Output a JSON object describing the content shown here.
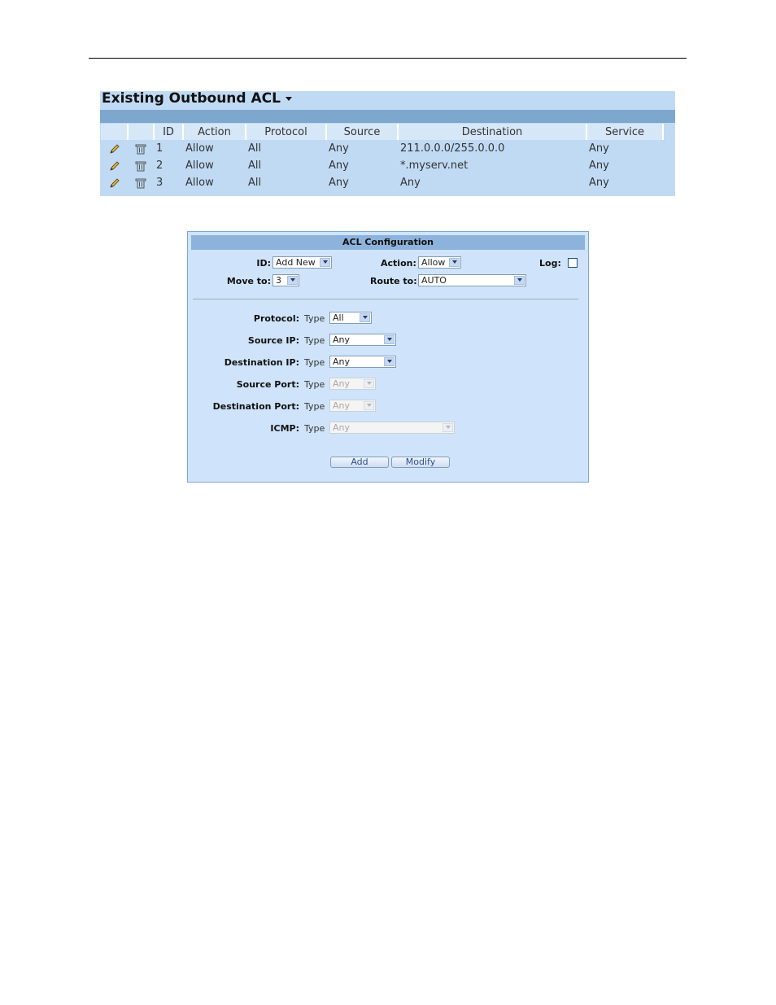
{
  "acl_list": {
    "title": "Existing Outbound ACL",
    "columns": [
      "",
      "",
      "ID",
      "Action",
      "Protocol",
      "Source",
      "Destination",
      "Service"
    ],
    "rows": [
      {
        "id": "1",
        "action": "Allow",
        "protocol": "All",
        "source": "Any",
        "destination": "211.0.0.0/255.0.0.0",
        "service": "Any"
      },
      {
        "id": "2",
        "action": "Allow",
        "protocol": "All",
        "source": "Any",
        "destination": "*.myserv.net",
        "service": "Any"
      },
      {
        "id": "3",
        "action": "Allow",
        "protocol": "All",
        "source": "Any",
        "destination": "Any",
        "service": "Any"
      }
    ],
    "row_icons": [
      "pencil-icon",
      "trash-icon"
    ]
  },
  "acl_config": {
    "title": "ACL Configuration",
    "id": {
      "label": "ID:",
      "value": "Add New"
    },
    "action": {
      "label": "Action:",
      "value": "Allow"
    },
    "log": {
      "label": "Log:",
      "checked": false
    },
    "move_to": {
      "label": "Move to:",
      "value": "3"
    },
    "route_to": {
      "label": "Route to:",
      "value": "AUTO"
    },
    "type_label": "Type",
    "protocol": {
      "label": "Protocol:",
      "value": "All"
    },
    "source_ip": {
      "label": "Source IP:",
      "value": "Any"
    },
    "destination_ip": {
      "label": "Destination IP:",
      "value": "Any"
    },
    "source_port": {
      "label": "Source Port:",
      "value": "Any",
      "disabled": true
    },
    "destination_port": {
      "label": "Destination Port:",
      "value": "Any",
      "disabled": true
    },
    "icmp": {
      "label": "ICMP:",
      "value": "Any",
      "disabled": true
    },
    "buttons": {
      "add": "Add",
      "modify": "Modify"
    }
  },
  "colors": {
    "panel_bg": "#c0daf4",
    "header_bar": "#7ea7cd",
    "config_bg": "#cfe4fa",
    "config_header": "#8db3dc"
  }
}
